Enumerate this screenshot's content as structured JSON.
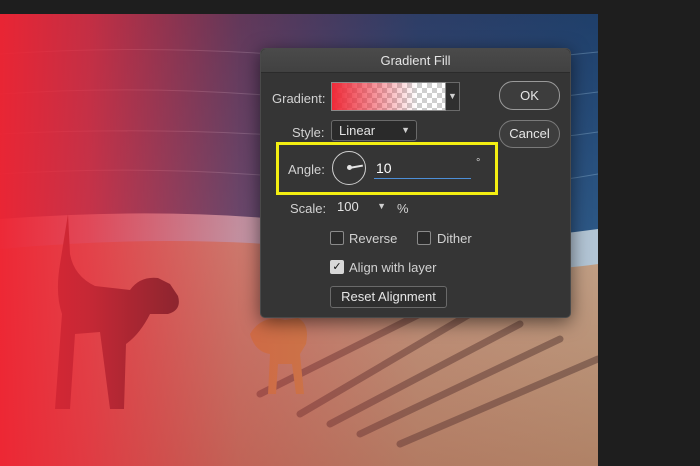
{
  "dialog": {
    "title": "Gradient Fill",
    "gradient_label": "Gradient:",
    "style_label": "Style:",
    "style_value": "Linear",
    "angle_label": "Angle:",
    "angle_value": "10",
    "angle_unit": "°",
    "scale_label": "Scale:",
    "scale_value": "100",
    "scale_unit": "%",
    "reverse_label": "Reverse",
    "reverse_checked": false,
    "dither_label": "Dither",
    "dither_checked": false,
    "align_label": "Align with layer",
    "align_checked": true,
    "reset_label": "Reset Alignment",
    "ok_label": "OK",
    "cancel_label": "Cancel"
  },
  "icons": {
    "dropdown": "chevron-down-icon",
    "angle": "angle-wheel-icon",
    "check": "checkmark-icon"
  },
  "colors": {
    "gradient_start": "#ee2a38",
    "highlight": "#f4ef12",
    "input_focus": "#4d8fd8"
  }
}
